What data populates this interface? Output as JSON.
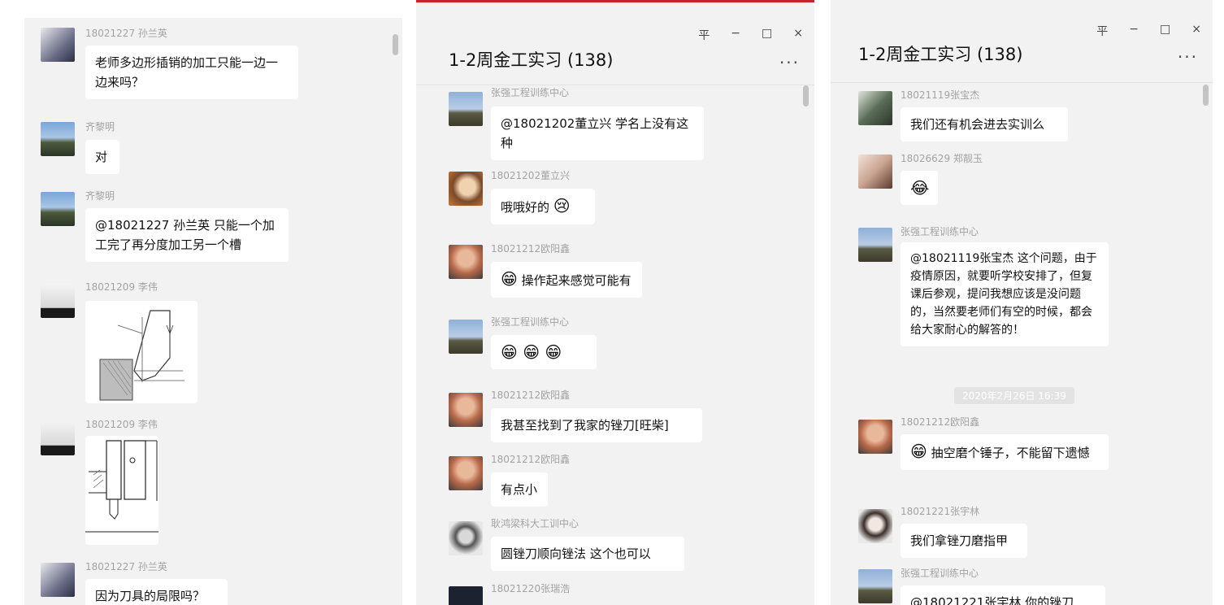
{
  "panel1": {
    "messages": [
      {
        "sender": "18021227  孙兰英",
        "text": "老师多边形插销的加工只能一边一边来吗？"
      },
      {
        "sender": "齐黎明",
        "text": "对"
      },
      {
        "sender": "齐黎明",
        "text": "@18021227  孙兰英 只能一个加工完了再分度加工另一个槽"
      },
      {
        "sender": "18021209 李伟",
        "image": "machining-diagram-1"
      },
      {
        "sender": "18021209 李伟",
        "image": "machining-diagram-2"
      },
      {
        "sender": "18021227  孙兰英",
        "text": "因为刀具的局限吗？"
      }
    ]
  },
  "panel2": {
    "title": "1-2周金工实习 (138)",
    "buttons": {
      "pin": "平",
      "minimize": "−",
      "maximize": "□",
      "close": "×",
      "more": "···"
    },
    "messages": [
      {
        "sender": "张强工程训练中心",
        "text": "@18021202董立兴 学名上没有这种"
      },
      {
        "sender": "18021202董立兴",
        "text": "哦哦好的",
        "emoji": "😢"
      },
      {
        "sender": "18021212欧阳鑫",
        "emoji": "😁",
        "text": "操作起来感觉可能有"
      },
      {
        "sender": "张强工程训练中心",
        "text": "😁 😁 😁"
      },
      {
        "sender": "18021212欧阳鑫",
        "text": "我甚至找到了我家的锉刀[旺柴]"
      },
      {
        "sender": "18021212欧阳鑫",
        "text": "有点小"
      },
      {
        "sender": "耿鸿梁科大工训中心",
        "text": "圆锉刀顺向锉法  这个也可以"
      },
      {
        "sender": "18021220张瑞浩"
      }
    ]
  },
  "panel3": {
    "title": "1-2周金工实习 (138)",
    "buttons": {
      "pin": "平",
      "minimize": "−",
      "maximize": "□",
      "close": "×",
      "more": "···"
    },
    "timestamp": "2020年2月26日 16:39",
    "messages": [
      {
        "sender": "18021119张宝杰",
        "text": "我们还有机会进去实训么"
      },
      {
        "sender": "18026629 郑靓玉",
        "text": "😂"
      },
      {
        "sender": "张强工程训练中心",
        "text": "@18021119张宝杰 这个问题，由于疫情原因，就要听学校安排了，但复课后参观，提问我想应该是没问题的，当然要老师们有空的时候，都会给大家耐心的解答的！"
      },
      {
        "sender": "18021212欧阳鑫",
        "emoji": "😁",
        "text": "抽空磨个锤子，不能留下遗憾"
      },
      {
        "sender": "18021221张宇林",
        "text": "我们拿锉刀磨指甲"
      },
      {
        "sender": "张强工程训练中心",
        "text": "@18021221张宇林 你的锉刀"
      }
    ]
  }
}
